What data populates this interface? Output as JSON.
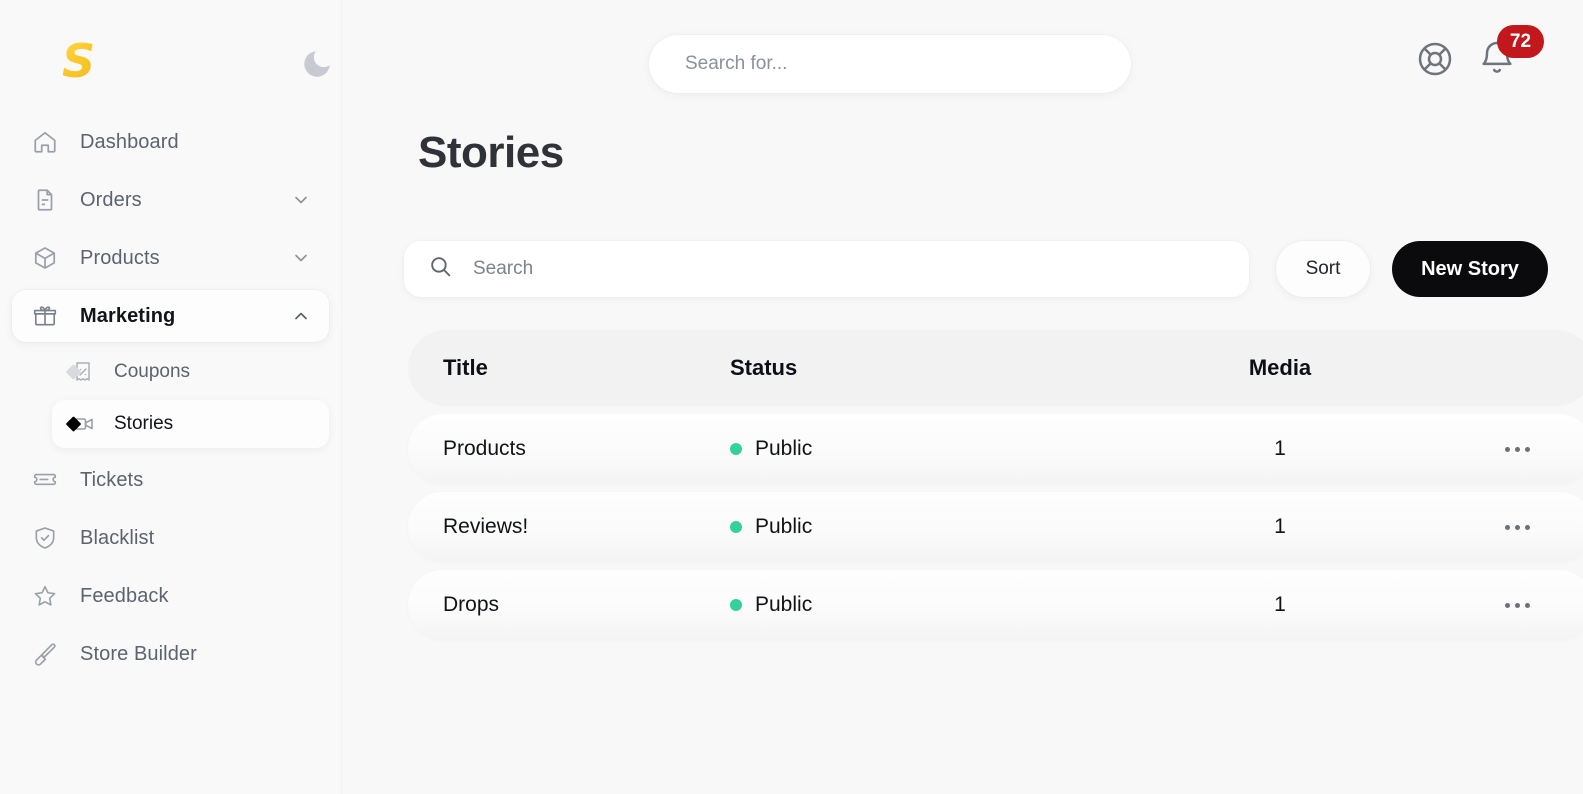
{
  "brand": {
    "logo_letter": "S",
    "logo_color": "#fbc92c"
  },
  "header": {
    "theme_toggle_icon": "moon-icon",
    "search": {
      "placeholder": "Search for...",
      "value": ""
    },
    "help_icon": "lifebuoy-icon",
    "notifications": {
      "icon": "bell-icon",
      "count": "72",
      "badge_color": "#c2181c"
    }
  },
  "sidebar": {
    "items": [
      {
        "label": "Dashboard",
        "icon": "home-icon",
        "expandable": false,
        "active": false
      },
      {
        "label": "Orders",
        "icon": "document-icon",
        "expandable": true,
        "chevron": "chevron-down-icon",
        "active": false
      },
      {
        "label": "Products",
        "icon": "box-icon",
        "expandable": true,
        "chevron": "chevron-down-icon",
        "active": false
      },
      {
        "label": "Marketing",
        "icon": "gift-icon",
        "expandable": true,
        "chevron": "chevron-up-icon",
        "active": true
      },
      {
        "label": "Tickets",
        "icon": "ticket-icon",
        "expandable": false,
        "active": false
      },
      {
        "label": "Blacklist",
        "icon": "shield-check-icon",
        "expandable": false,
        "active": false
      },
      {
        "label": "Feedback",
        "icon": "star-icon",
        "expandable": false,
        "active": false
      },
      {
        "label": "Store Builder",
        "icon": "paintbrush-icon",
        "expandable": false,
        "active": false
      }
    ],
    "marketing_submenu": [
      {
        "label": "Coupons",
        "icon": "receipt-percent-icon",
        "active": false
      },
      {
        "label": "Stories",
        "icon": "video-camera-icon",
        "active": true
      }
    ]
  },
  "main": {
    "title": "Stories",
    "search": {
      "placeholder": "Search",
      "value": "",
      "icon": "search-icon"
    },
    "sort_label": "Sort",
    "new_story_label": "New Story"
  },
  "table": {
    "columns": [
      "Title",
      "Status",
      "Media"
    ],
    "status_dot_color": "#34d29a",
    "row_menu_icon": "ellipsis-icon",
    "rows": [
      {
        "title": "Products",
        "status": "Public",
        "media": "1"
      },
      {
        "title": "Reviews!",
        "status": "Public",
        "media": "1"
      },
      {
        "title": "Drops",
        "status": "Public",
        "media": "1"
      }
    ]
  }
}
